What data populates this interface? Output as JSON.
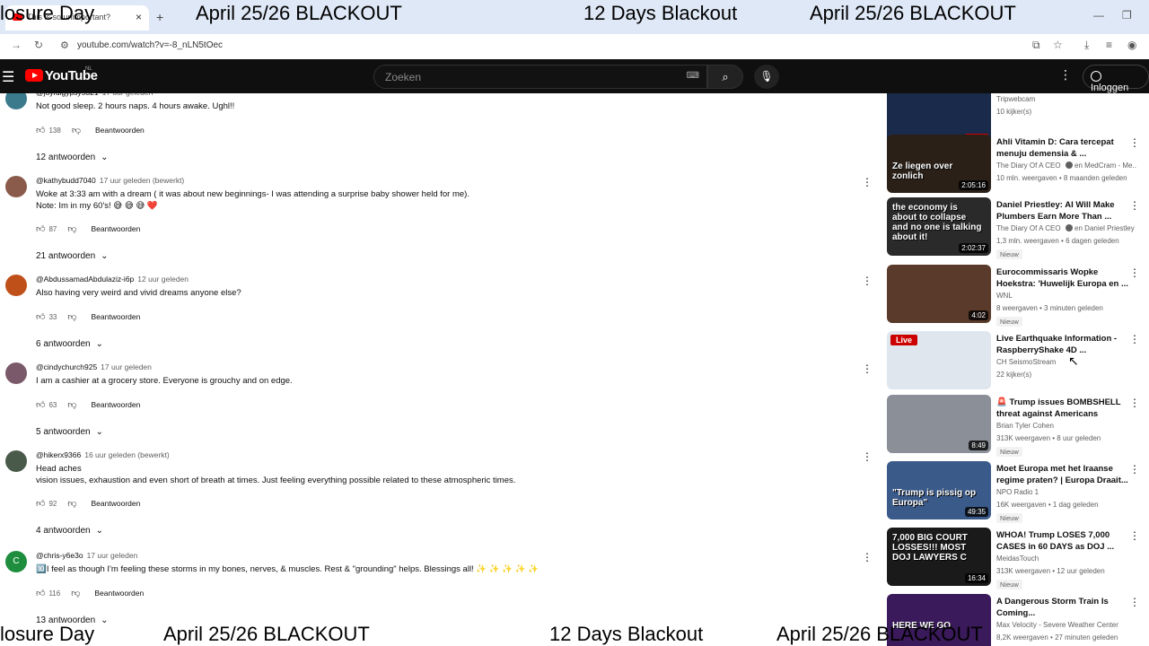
{
  "browser": {
    "tab_title": "This is so unimportant?",
    "url": "youtube.com/watch?v=-8_nLN5tOec"
  },
  "banners": {
    "top": [
      "losure Day",
      "April 25/26 BLACKOUT",
      "12 Days Blackout",
      "April 25/26 BLACKOUT"
    ],
    "bottom": [
      "losure Day",
      "April 25/26 BLACKOUT",
      "12 Days Blackout",
      "April 25/26 BLACKOUT"
    ]
  },
  "header": {
    "logo_text": "YouTube",
    "country": "NL",
    "search_placeholder": "Zoeken",
    "signin_label": "Inloggen"
  },
  "comments": [
    {
      "author": "@joyfulgypsy5321",
      "time": "17 uur geleden",
      "text": "Not good sleep. 2 hours naps. 4 hours awake. Ughl!!",
      "likes": "138",
      "reply_label": "Beantwoorden",
      "replies": "12 antwoorden",
      "avatar_color": "#3a7a8c"
    },
    {
      "author": "@kathybudd7040",
      "time": "17 uur geleden (bewerkt)",
      "text": "Woke at 3:33 am with a dream ( it was about new beginnings- I was attending a surprise baby shower held for me).",
      "text2": "Note:  Im in my 60's! 😅 😅 😅  ❤️",
      "likes": "87",
      "reply_label": "Beantwoorden",
      "replies": "21 antwoorden",
      "avatar_color": "#8a5a4a"
    },
    {
      "author": "@AbdussamadAbdulaziz-i6p",
      "time": "12 uur geleden",
      "text": "Also having very weird and vivid dreams anyone else?",
      "likes": "33",
      "reply_label": "Beantwoorden",
      "replies": "6 antwoorden",
      "avatar_color": "#c0501a"
    },
    {
      "author": "@cindychurch925",
      "time": "17 uur geleden",
      "text": "I am a cashier at a grocery store. Everyone is grouchy and on edge.",
      "likes": "63",
      "reply_label": "Beantwoorden",
      "replies": "5 antwoorden",
      "avatar_color": "#7a5a6a"
    },
    {
      "author": "@hikerx9366",
      "time": "16 uur geleden (bewerkt)",
      "text": "Head aches",
      "text2": "vision issues, exhaustion and even short of breath at times. Just feeling everything possible related to these atmospheric times.",
      "likes": "92",
      "reply_label": "Beantwoorden",
      "replies": "4 antwoorden",
      "avatar_color": "#4a5a4a"
    },
    {
      "author": "@chris-y6e3o",
      "time": "17 uur geleden",
      "text": "🔟I feel as though I'm feeling these storms in my bones, nerves, & muscles.  Rest & \"grounding\" helps.  Blessings all!  ✨ ✨ ✨ ✨ ✨",
      "likes": "116",
      "reply_label": "Beantwoorden",
      "replies": "13 antwoorden",
      "avatar_color": "#1e8e3e",
      "avatar_letter": "C"
    }
  ],
  "recommendations": [
    {
      "title": "",
      "channel": "Tripwebcam",
      "meta": "10 kijker(s)",
      "thumb_color": "#1a2a4a",
      "thumb_label": "LIVE"
    },
    {
      "title": "Ahli Vitamin D: Cara tercepat menuju demensia & ...",
      "channel": "The Diary Of A CEO",
      "channel_extra": "en MedCram - Me...",
      "meta": "10 mln. weergaven • 8 maanden geleden",
      "duration": "2:05:16",
      "thumb_color": "#2a2018",
      "thumb_text": "Ze liegen over zonlich"
    },
    {
      "title": "Daniel Priestley: AI Will Make Plumbers Earn More Than ...",
      "channel": "The Diary Of A CEO",
      "channel_extra": "en Daniel Priestley",
      "meta": "1,3 mln. weergaven • 6 dagen geleden",
      "badge": "Nieuw",
      "duration": "2:02:37",
      "thumb_color": "#2a2a2a",
      "thumb_text": "the economy is about to collapse and no one is talking about it!"
    },
    {
      "title": "Eurocommissaris Wopke Hoekstra: 'Huwelijk Europa en ...",
      "channel": "WNL",
      "meta": "8 weergaven • 3 minuten geleden",
      "badge": "Nieuw",
      "duration": "4:02",
      "thumb_color": "#5a3a2a"
    },
    {
      "title": "Live Earthquake Information - RaspberryShake 4D ...",
      "channel": "CH SeismoStream",
      "meta": "22 kijker(s)",
      "thumb_color": "#dfe6ee",
      "thumb_label": "Live"
    },
    {
      "title": "🚨 Trump issues BOMBSHELL threat against Americans",
      "channel": "Brian Tyler Cohen",
      "meta": "313K weergaven • 8 uur geleden",
      "badge": "Nieuw",
      "duration": "8:49",
      "thumb_color": "#8a8f98"
    },
    {
      "title": "Moet Europa met het Iraanse regime praten? | Europa Draait...",
      "channel": "NPO Radio 1",
      "meta": "16K weergaven • 1 dag geleden",
      "badge": "Nieuw",
      "duration": "49:35",
      "thumb_color": "#3a5a8a",
      "thumb_text": "\"Trump is pissig op Europa\""
    },
    {
      "title": "WHOA! Trump LOSES 7,000 CASES in 60 DAYS as DOJ ...",
      "channel": "MeidasTouch",
      "meta": "313K weergaven • 12 uur geleden",
      "badge": "Nieuw",
      "duration": "16:34",
      "thumb_color": "#1a1a1a",
      "thumb_text": "7,000 BIG COURT LOSSES!!! MOST DOJ LAWYERS C"
    },
    {
      "title": "A Dangerous Storm Train Is Coming...",
      "channel": "Max Velocity - Severe Weather Center",
      "meta": "8,2K weergaven • 27 minuten geleden",
      "thumb_color": "#3a1a5a",
      "thumb_text": "HERE WE GO"
    }
  ]
}
